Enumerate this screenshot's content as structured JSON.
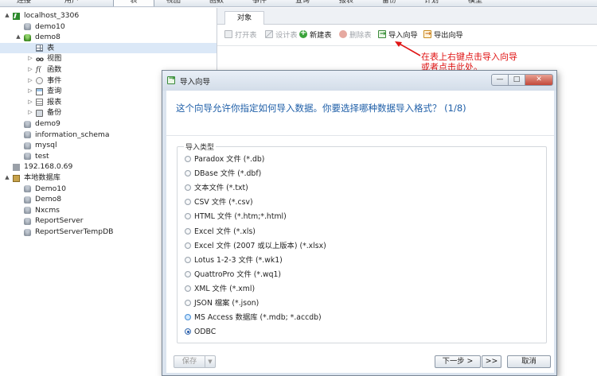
{
  "topbar": {
    "items": [
      {
        "label": "连接"
      },
      {
        "label": "用户"
      },
      {
        "label": "表",
        "active": true
      },
      {
        "label": "视图"
      },
      {
        "label": "函数"
      },
      {
        "label": "事件"
      },
      {
        "label": "查询"
      },
      {
        "label": "报表"
      },
      {
        "label": "备份"
      },
      {
        "label": "计划"
      },
      {
        "label": "模型"
      }
    ]
  },
  "tree": {
    "rows": [
      {
        "label": "localhost_3306",
        "icon": "connection-green-icon",
        "arrow": "▲"
      },
      {
        "label": "demo10",
        "icon": "database-icon"
      },
      {
        "label": "demo8",
        "icon": "database-open-icon",
        "arrow": "▲"
      },
      {
        "label": "表",
        "icon": "table-icon",
        "selected": true
      },
      {
        "label": "视图",
        "icon": "view-icon",
        "arrow": "▷"
      },
      {
        "label": "函数",
        "icon": "function-icon",
        "arrow": "▷"
      },
      {
        "label": "事件",
        "icon": "event-icon",
        "arrow": "▷"
      },
      {
        "label": "查询",
        "icon": "query-icon",
        "arrow": "▷"
      },
      {
        "label": "报表",
        "icon": "report-icon",
        "arrow": "▷"
      },
      {
        "label": "备份",
        "icon": "backup-icon",
        "arrow": "▷"
      },
      {
        "label": "demo9",
        "icon": "database-icon"
      },
      {
        "label": "information_schema",
        "icon": "database-icon"
      },
      {
        "label": "mysql",
        "icon": "database-icon"
      },
      {
        "label": "test",
        "icon": "database-icon"
      },
      {
        "label": "192.168.0.69",
        "icon": "connection-grey-icon"
      },
      {
        "label": "本地数据库",
        "icon": "local-database-icon",
        "arrow": "▲"
      },
      {
        "label": "Demo10",
        "icon": "database-icon"
      },
      {
        "label": "Demo8",
        "icon": "database-icon"
      },
      {
        "label": "Nxcms",
        "icon": "database-icon"
      },
      {
        "label": "ReportServer",
        "icon": "database-icon"
      },
      {
        "label": "ReportServerTempDB",
        "icon": "database-icon"
      }
    ]
  },
  "objects": {
    "tab_label": "对象",
    "toolbar": [
      {
        "label": "打开表",
        "icon": "open-table-icon",
        "disabled": true
      },
      {
        "label": "设计表",
        "icon": "design-table-icon",
        "disabled": true
      },
      {
        "label": "新建表",
        "icon": "new-table-icon",
        "disabled": false
      },
      {
        "label": "删除表",
        "icon": "delete-table-icon",
        "disabled": true
      },
      {
        "label": "导入向导",
        "icon": "import-wizard-icon",
        "disabled": false
      },
      {
        "label": "导出向导",
        "icon": "export-wizard-icon",
        "disabled": false
      }
    ]
  },
  "annotation": {
    "line1": "在表上右键点击导入向导",
    "line2": "或者点击此处。",
    "color": "#e01515"
  },
  "dialog": {
    "title": "导入向导",
    "heading": "这个向导允许你指定如何导入数据。你要选择哪种数据导入格式？ (1/8)",
    "group_label": "导入类型",
    "options": [
      {
        "label": "Paradox 文件 (*.db)"
      },
      {
        "label": "DBase 文件 (*.dbf)"
      },
      {
        "label": "文本文件 (*.txt)"
      },
      {
        "label": "CSV 文件 (*.csv)"
      },
      {
        "label": "HTML 文件 (*.htm;*.html)"
      },
      {
        "label": "Excel 文件 (*.xls)"
      },
      {
        "label": "Excel 文件 (2007 或以上版本) (*.xlsx)"
      },
      {
        "label": "Lotus 1-2-3 文件 (*.wk1)"
      },
      {
        "label": "QuattroPro 文件 (*.wq1)"
      },
      {
        "label": "XML 文件 (*.xml)"
      },
      {
        "label": "JSON 檔案 (*.json)"
      },
      {
        "label": "MS Access 数据库 (*.mdb; *.accdb)",
        "hover": true
      },
      {
        "label": "ODBC",
        "selected": true
      }
    ],
    "buttons": {
      "save": "保存",
      "next": "下一步 >",
      "last": ">>",
      "cancel": "取消"
    },
    "window_controls": {
      "minimize": "—",
      "maximize": "□",
      "close": "✕"
    }
  }
}
